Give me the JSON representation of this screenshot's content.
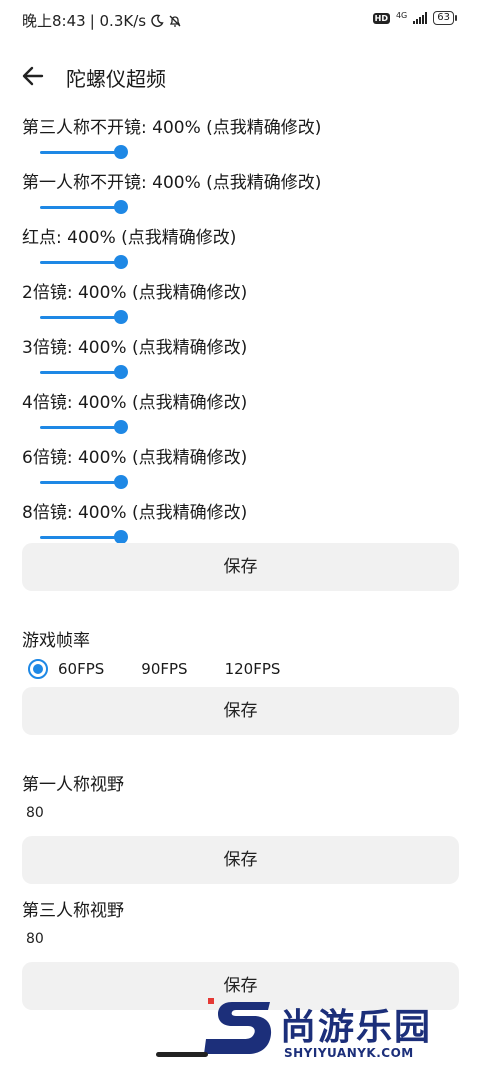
{
  "status_bar": {
    "time": "晚上8:43",
    "speed": "| 0.3K/s",
    "hd": "HD",
    "network": "4G",
    "battery": "63"
  },
  "appbar": {
    "title": "陀螺仪超频"
  },
  "sliders": [
    {
      "label": "第三人称不开镜: 400% (点我精确修改)"
    },
    {
      "label": "第一人称不开镜: 400% (点我精确修改)"
    },
    {
      "label": "红点: 400% (点我精确修改)"
    },
    {
      "label": "2倍镜: 400% (点我精确修改)"
    },
    {
      "label": "3倍镜: 400% (点我精确修改)"
    },
    {
      "label": "4倍镜: 400% (点我精确修改)"
    },
    {
      "label": "6倍镜: 400% (点我精确修改)"
    },
    {
      "label": "8倍镜: 400% (点我精确修改)"
    }
  ],
  "save_label": "保存",
  "frame_rate": {
    "label": "游戏帧率",
    "options": [
      "60FPS",
      "90FPS",
      "120FPS"
    ],
    "selected": "60FPS"
  },
  "fov_first": {
    "label": "第一人称视野",
    "value": "80"
  },
  "fov_third": {
    "label": "第三人称视野",
    "value": "80"
  },
  "watermark": {
    "cn": "尚游乐园",
    "en": "SHYIYUANYK.COM"
  },
  "colors": {
    "accent": "#1e88e5",
    "button_bg": "#f1f1f1",
    "watermark": "#1c2f7a",
    "watermark_red": "#e53935"
  }
}
